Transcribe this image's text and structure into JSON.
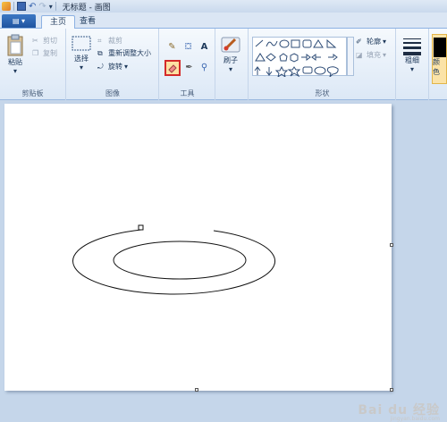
{
  "window": {
    "title": "无标题 - 画图"
  },
  "tabs": [
    {
      "label": "主页"
    },
    {
      "label": "查看"
    }
  ],
  "ribbon": {
    "clipboard": {
      "group_label": "剪贴板",
      "paste": "粘贴",
      "cut": "剪切",
      "copy": "复制"
    },
    "image": {
      "group_label": "图像",
      "select": "选择",
      "crop": "裁剪",
      "resize": "重新调整大小",
      "rotate": "旋转"
    },
    "tools": {
      "group_label": "工具",
      "selected_tool": "eraser"
    },
    "brushes": {
      "label": "刷子"
    },
    "shapes": {
      "group_label": "形状",
      "outline": "轮廓",
      "fill": "填充"
    },
    "size": {
      "label": "粗细"
    },
    "color1": {
      "label": "颜色"
    }
  },
  "watermark": {
    "text": "Bai du 经验",
    "sub": "jingyan.baidu.com"
  },
  "colors": {
    "accent": "#1f54a0",
    "ribbon_bg": "#f5f9fd",
    "work_bg": "#c5d6ea",
    "tool_highlight": "#d42a2a"
  }
}
